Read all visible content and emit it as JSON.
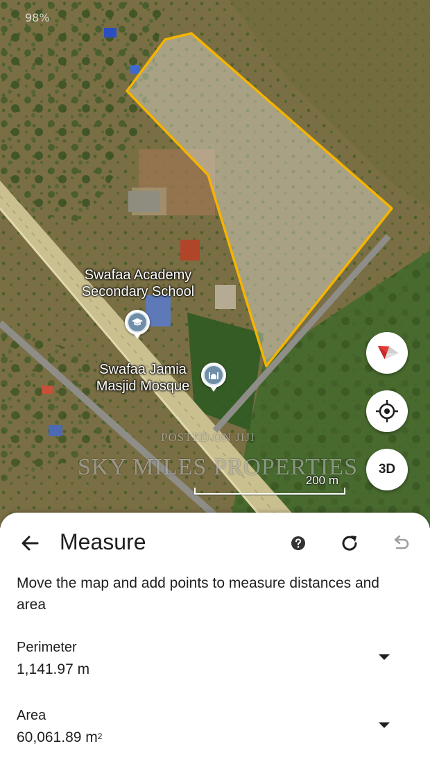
{
  "status": {
    "battery": "98%"
  },
  "map": {
    "places": [
      {
        "name": "Swafaa Academy Secondary School",
        "icon": "school-icon"
      },
      {
        "name": "Swafaa Jamia Masjid Mosque",
        "icon": "mosque-icon"
      }
    ],
    "watermark_posted": "POSTED ON JIJI",
    "watermark_brand": "SKY MILES PROPERTIES",
    "scale_label": "200 m",
    "buttons": {
      "compass": "compass-icon",
      "locate": "my-location-icon",
      "three_d": "3D"
    },
    "polygon_color": "#f5b400"
  },
  "sheet": {
    "title": "Measure",
    "icons": {
      "back": "arrow-back-icon",
      "help": "help-icon",
      "reset": "refresh-icon",
      "undo": "undo-icon"
    },
    "instructions": "Move the map and add points to measure distances and area",
    "perimeter": {
      "label": "Perimeter",
      "value": "1,141.97 m"
    },
    "area": {
      "label": "Area",
      "value": "60,061.89 m",
      "unit_superscript": "2"
    }
  }
}
